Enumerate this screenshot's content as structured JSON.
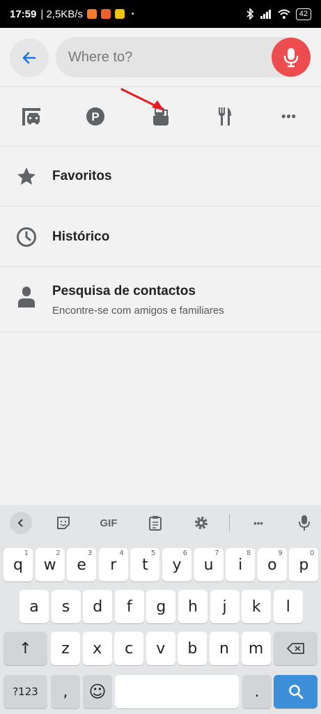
{
  "status_bar": {
    "time": "17:59",
    "speed": "| 2,5KB/s",
    "dot": "•",
    "battery": "42"
  },
  "search": {
    "placeholder": "Where to?"
  },
  "categories": [
    {
      "icon": "garage-icon"
    },
    {
      "icon": "parking-icon",
      "label": "P"
    },
    {
      "icon": "fuel-station-icon"
    },
    {
      "icon": "restaurant-icon"
    },
    {
      "icon": "more-icon",
      "label": "•••"
    }
  ],
  "list": {
    "favorites": {
      "title": "Favoritos"
    },
    "history": {
      "title": "Histórico"
    },
    "contacts": {
      "title": "Pesquisa de contactos",
      "subtitle": "Encontre-se com amigos e familiares"
    }
  },
  "keyboard": {
    "toolbar": {
      "gif": "GIF",
      "more": "•••"
    },
    "row1": [
      {
        "k": "q",
        "h": "1"
      },
      {
        "k": "w",
        "h": "2"
      },
      {
        "k": "e",
        "h": "3"
      },
      {
        "k": "r",
        "h": "4"
      },
      {
        "k": "t",
        "h": "5"
      },
      {
        "k": "y",
        "h": "6"
      },
      {
        "k": "u",
        "h": "7"
      },
      {
        "k": "i",
        "h": "8"
      },
      {
        "k": "o",
        "h": "9"
      },
      {
        "k": "p",
        "h": "0"
      }
    ],
    "row2": [
      "a",
      "s",
      "d",
      "f",
      "g",
      "h",
      "j",
      "k",
      "l"
    ],
    "row3": [
      "z",
      "x",
      "c",
      "v",
      "b",
      "n",
      "m"
    ],
    "symbols": "?123",
    "comma": ",",
    "period": ".",
    "shift": "↑",
    "emoji": "☺"
  },
  "colors": {
    "accent": "#1a73e8",
    "mic": "#ee4d50",
    "icon_gray": "#5f6368",
    "arrow_red": "#e51c23"
  }
}
